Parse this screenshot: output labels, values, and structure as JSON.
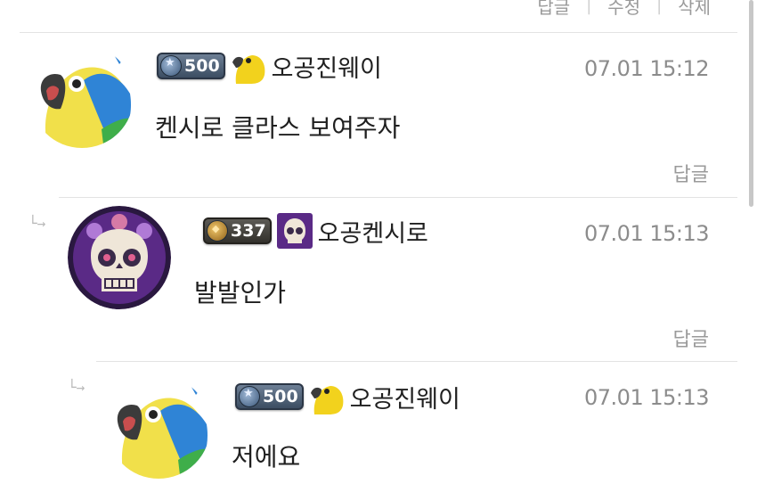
{
  "top_actions": {
    "reply": "답글",
    "edit": "수정",
    "delete": "삭제"
  },
  "comments": [
    {
      "level": "500",
      "nickname": "오공진웨이",
      "timestamp": "07.01 15:12",
      "content": "켄시로 클라스 보여주자",
      "reply_label": "답글"
    },
    {
      "level": "337",
      "nickname": "오공켄시로",
      "timestamp": "07.01 15:13",
      "content": "발발인가",
      "reply_label": "답글"
    },
    {
      "level": "500",
      "nickname": "오공진웨이",
      "timestamp": "07.01 15:13",
      "content": "저에요"
    }
  ],
  "colors": {
    "text": "#1f1f1f",
    "muted": "#8c8c8c",
    "divider": "#e3e3e3"
  },
  "icons": {
    "reply_indent": "reply-arrow-icon",
    "avatar_parrot": "parrot-icon",
    "avatar_skull": "skull-icon"
  }
}
